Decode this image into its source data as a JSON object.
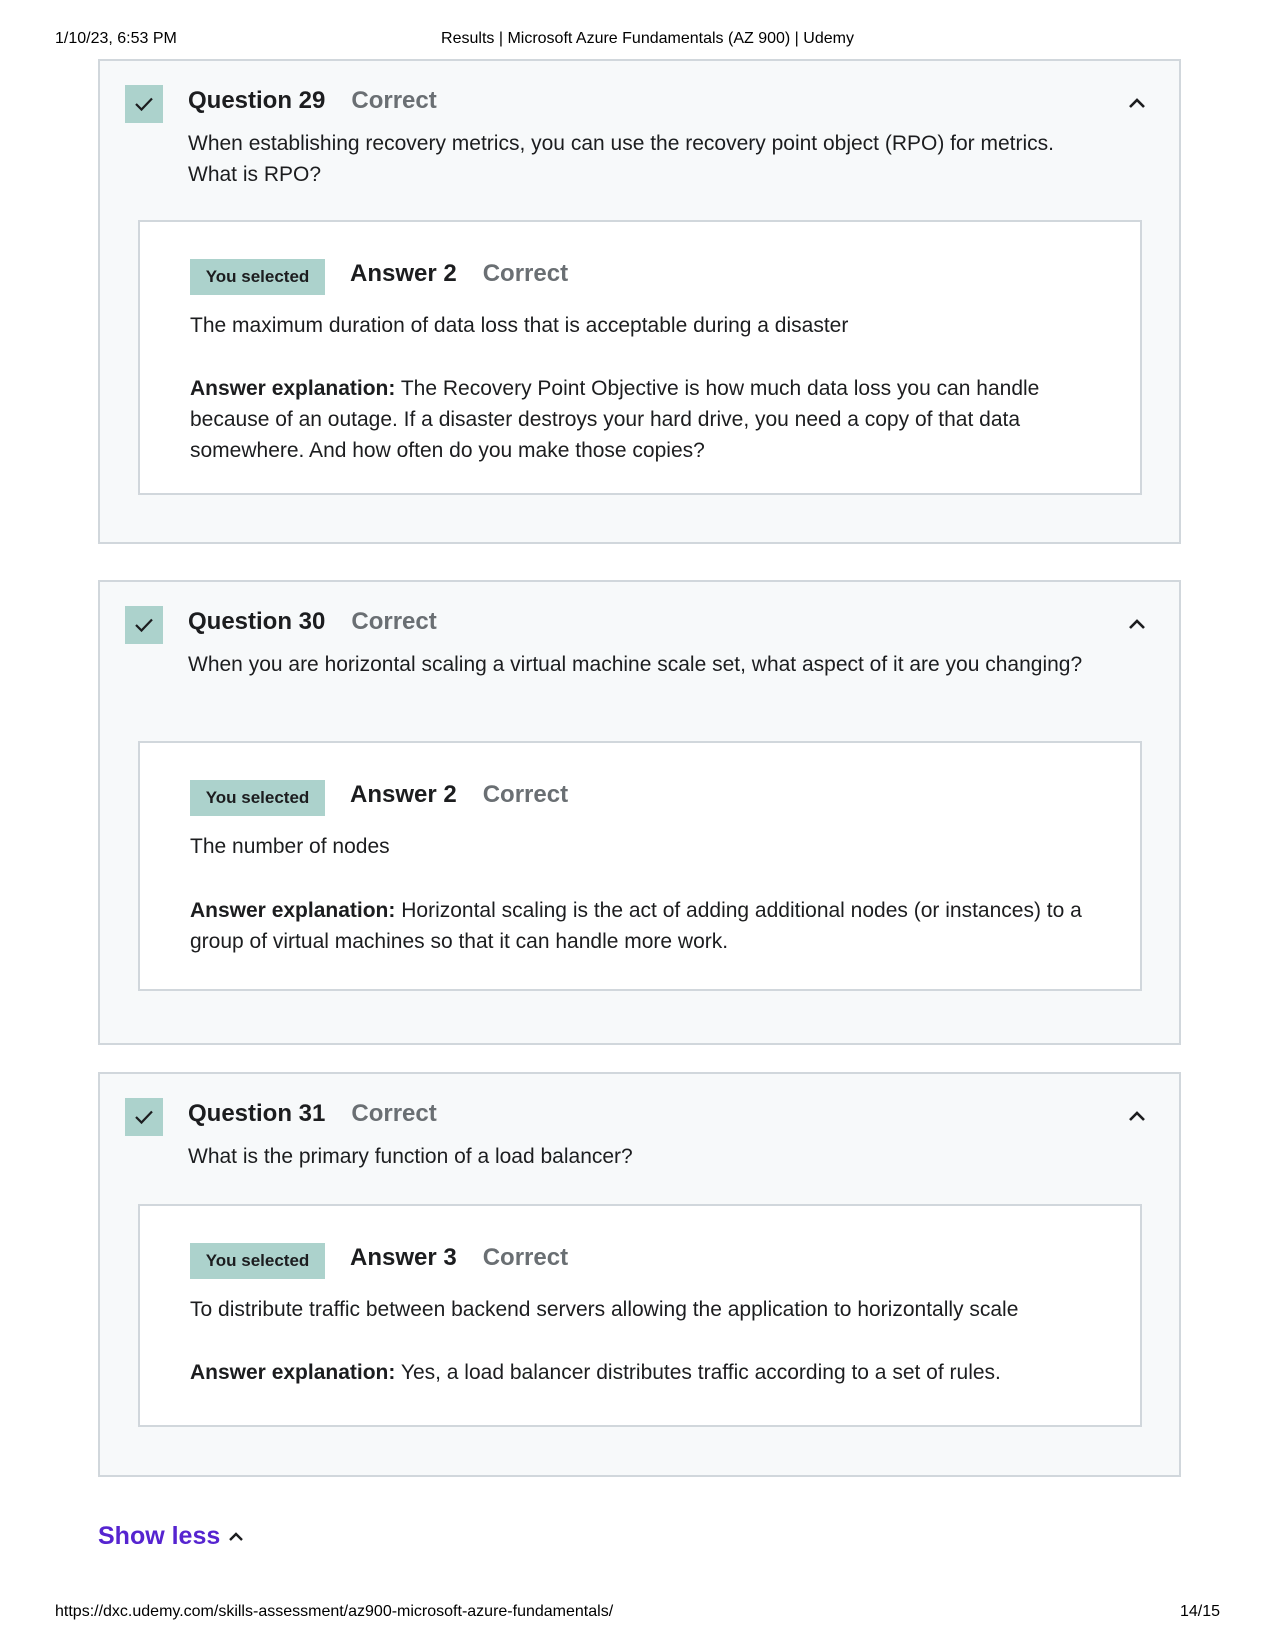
{
  "print_header": {
    "date": "1/10/23, 6:53 PM",
    "title": "Results | Microsoft Azure Fundamentals (AZ 900) | Udemy"
  },
  "print_footer": {
    "url": "https://dxc.udemy.com/skills-assessment/az900-microsoft-azure-fundamentals/",
    "page": "14/15"
  },
  "questions": [
    {
      "title": "Question 29",
      "status": "Correct",
      "text": "When establishing recovery metrics, you can use the recovery point object (RPO) for metrics. What is RPO?",
      "answer": {
        "badge": "You selected",
        "title": "Answer 2",
        "status": "Correct",
        "text": "The maximum duration of data loss that is acceptable during a disaster",
        "explanation_label": "Answer explanation:",
        "explanation": "The Recovery Point Objective is how much data loss you can handle because of an outage. If a disaster destroys your hard drive, you need a copy of that data somewhere. And how often do you make those copies?"
      }
    },
    {
      "title": "Question 30",
      "status": "Correct",
      "text": "When you are horizontal scaling a virtual machine scale set, what aspect of it are you changing?",
      "answer": {
        "badge": "You selected",
        "title": "Answer 2",
        "status": "Correct",
        "text": "The number of nodes",
        "explanation_label": "Answer explanation:",
        "explanation": "Horizontal scaling is the act of adding additional nodes (or instances) to a group of virtual machines so that it can handle more work."
      }
    },
    {
      "title": "Question 31",
      "status": "Correct",
      "text": "What is the primary function of a load balancer?",
      "answer": {
        "badge": "You selected",
        "title": "Answer 3",
        "status": "Correct",
        "text": "To distribute traffic between backend servers allowing the application to horizontally scale",
        "explanation_label": "Answer explanation:",
        "explanation": "Yes, a load balancer distributes traffic according to a set of rules."
      }
    }
  ],
  "show_less_label": "Show less",
  "icons": {
    "check": "check-icon",
    "collapse": "chevron-up-icon"
  },
  "colors": {
    "accent_purple": "#5624d0",
    "correct_badge": "#acd2cc",
    "muted_text": "#6a6f73",
    "card_bg": "#f7f9fa",
    "border": "#d1d7dc"
  }
}
